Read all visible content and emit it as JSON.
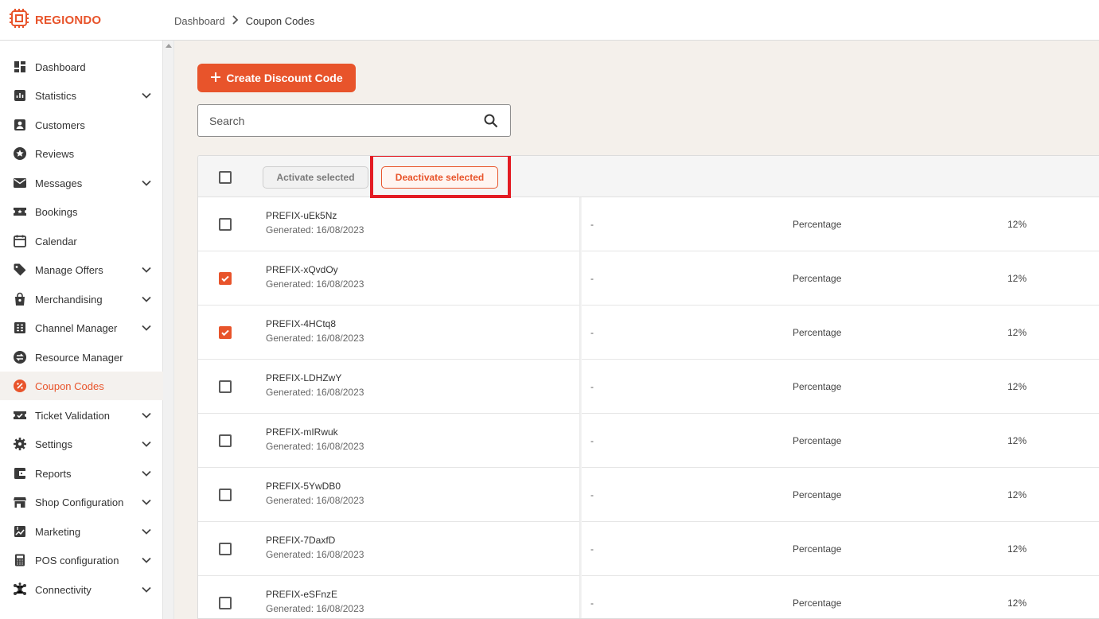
{
  "app": {
    "logo_text": "REGIONDO",
    "accent_color": "#e8542b",
    "highlight_color": "#e31b23"
  },
  "breadcrumb": {
    "items": [
      "Dashboard",
      "Coupon Codes"
    ]
  },
  "sidebar": {
    "items": [
      {
        "label": "Dashboard",
        "icon": "dashboard-icon",
        "expandable": false,
        "active": false
      },
      {
        "label": "Statistics",
        "icon": "bar-chart-icon",
        "expandable": true,
        "active": false
      },
      {
        "label": "Customers",
        "icon": "person-icon",
        "expandable": false,
        "active": false
      },
      {
        "label": "Reviews",
        "icon": "star-icon",
        "expandable": false,
        "active": false
      },
      {
        "label": "Messages",
        "icon": "mail-icon",
        "expandable": true,
        "active": false
      },
      {
        "label": "Bookings",
        "icon": "ticket-icon",
        "expandable": false,
        "active": false
      },
      {
        "label": "Calendar",
        "icon": "calendar-icon",
        "expandable": false,
        "active": false
      },
      {
        "label": "Manage Offers",
        "icon": "tag-icon",
        "expandable": true,
        "active": false
      },
      {
        "label": "Merchandising",
        "icon": "shopping-bag-icon",
        "expandable": true,
        "active": false
      },
      {
        "label": "Channel Manager",
        "icon": "channel-icon",
        "expandable": true,
        "active": false
      },
      {
        "label": "Resource Manager",
        "icon": "swap-icon",
        "expandable": false,
        "active": false
      },
      {
        "label": "Coupon Codes",
        "icon": "percent-icon",
        "expandable": false,
        "active": true
      },
      {
        "label": "Ticket Validation",
        "icon": "ticket-check-icon",
        "expandable": true,
        "active": false
      },
      {
        "label": "Settings",
        "icon": "gear-icon",
        "expandable": true,
        "active": false
      },
      {
        "label": "Reports",
        "icon": "wallet-icon",
        "expandable": true,
        "active": false
      },
      {
        "label": "Shop Configuration",
        "icon": "store-icon",
        "expandable": true,
        "active": false
      },
      {
        "label": "Marketing",
        "icon": "marketing-icon",
        "expandable": true,
        "active": false
      },
      {
        "label": "POS configuration",
        "icon": "calculator-icon",
        "expandable": true,
        "active": false
      },
      {
        "label": "Connectivity",
        "icon": "hub-icon",
        "expandable": true,
        "active": false
      }
    ]
  },
  "toolbar": {
    "create_label": "Create Discount Code",
    "search_placeholder": "Search"
  },
  "table": {
    "activate_label": "Activate selected",
    "deactivate_label": "Deactivate selected",
    "rows": [
      {
        "code": "PREFIX-uEk5Nz",
        "generated": "Generated: 16/08/2023",
        "col2": "-",
        "type": "Percentage",
        "amount": "12%",
        "checked": false
      },
      {
        "code": "PREFIX-xQvdOy",
        "generated": "Generated: 16/08/2023",
        "col2": "-",
        "type": "Percentage",
        "amount": "12%",
        "checked": true
      },
      {
        "code": "PREFIX-4HCtq8",
        "generated": "Generated: 16/08/2023",
        "col2": "-",
        "type": "Percentage",
        "amount": "12%",
        "checked": true
      },
      {
        "code": "PREFIX-LDHZwY",
        "generated": "Generated: 16/08/2023",
        "col2": "-",
        "type": "Percentage",
        "amount": "12%",
        "checked": false
      },
      {
        "code": "PREFIX-mIRwuk",
        "generated": "Generated: 16/08/2023",
        "col2": "-",
        "type": "Percentage",
        "amount": "12%",
        "checked": false
      },
      {
        "code": "PREFIX-5YwDB0",
        "generated": "Generated: 16/08/2023",
        "col2": "-",
        "type": "Percentage",
        "amount": "12%",
        "checked": false
      },
      {
        "code": "PREFIX-7DaxfD",
        "generated": "Generated: 16/08/2023",
        "col2": "-",
        "type": "Percentage",
        "amount": "12%",
        "checked": false
      },
      {
        "code": "PREFIX-eSFnzE",
        "generated": "Generated: 16/08/2023",
        "col2": "-",
        "type": "Percentage",
        "amount": "12%",
        "checked": false
      }
    ]
  }
}
